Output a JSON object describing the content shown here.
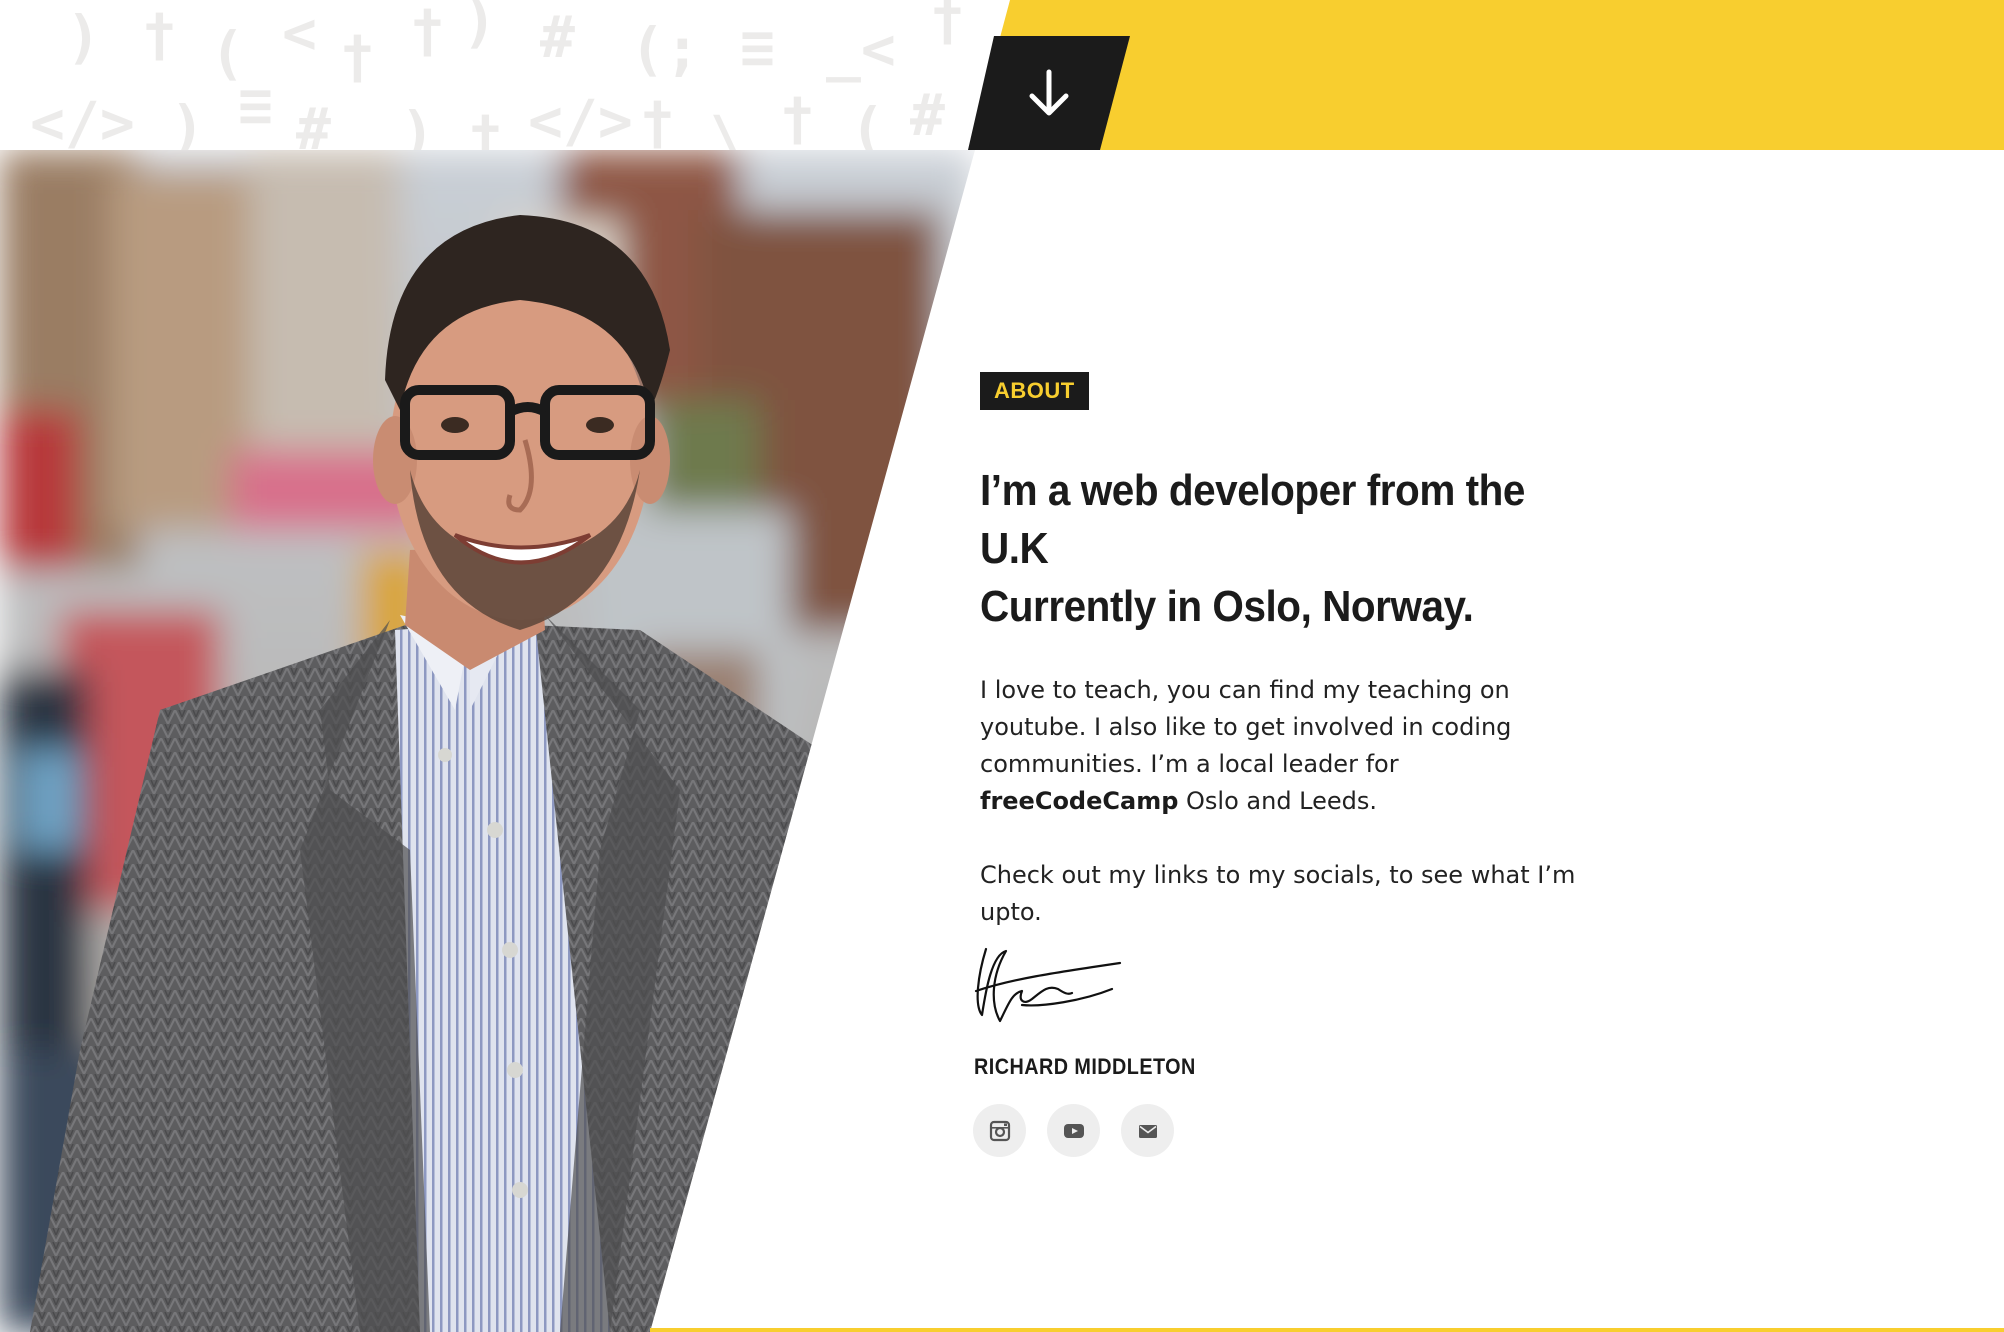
{
  "header": {
    "scroll_down_icon": "arrow-down-icon",
    "accent_color": "#f8ce2f",
    "dark_color": "#1b1b1b",
    "pattern_glyphs": [
      ")",
      "†",
      "(",
      "<",
      "†",
      "†",
      ")",
      "#",
      "(;",
      "≡",
      "_<",
      "†",
      "≡",
      "</>",
      ")",
      "#",
      ")",
      "†",
      "</>",
      "†",
      "\\",
      "†",
      "(",
      "#"
    ]
  },
  "photo": {
    "alt": "Richard Middleton smiling on a city street"
  },
  "about": {
    "label": "ABOUT",
    "headline_line1": "I’m a web developer from the U.K",
    "headline_line2": "Currently in Oslo, Norway.",
    "bio_part1": "I love to teach, you can find my teaching on youtube. I also like to get involved in coding communities. I’m a local leader for ",
    "bio_bold": "freeCodeCamp",
    "bio_part2": " Oslo and Leeds.",
    "bio_paragraph2": "Check out my links to my socials, to see what I’m upto.",
    "signature_name": "RICHARD MIDDLETON"
  },
  "socials": [
    {
      "icon": "instagram-icon"
    },
    {
      "icon": "youtube-icon"
    },
    {
      "icon": "email-icon"
    }
  ]
}
